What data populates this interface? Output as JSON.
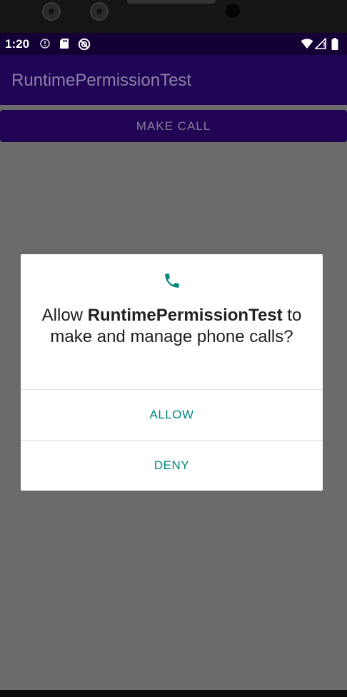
{
  "status_bar": {
    "time": "1:20",
    "left_icons": [
      "alert-icon",
      "sd-card-icon",
      "do-not-disturb-icon"
    ],
    "right_icons": [
      "wifi-icon",
      "cell-signal-icon",
      "battery-icon"
    ]
  },
  "app_bar": {
    "title": "RuntimePermissionTest"
  },
  "main": {
    "make_call_label": "MAKE CALL"
  },
  "dialog": {
    "icon": "phone-icon",
    "message_prefix": "Allow ",
    "app_name": "RuntimePermissionTest",
    "message_suffix": " to make and manage phone calls?",
    "allow_label": "ALLOW",
    "deny_label": "DENY"
  },
  "colors": {
    "status_bar": "#130136",
    "app_bar": "#200557",
    "accent": "#01877e",
    "scrim": "#6b6b6b"
  }
}
